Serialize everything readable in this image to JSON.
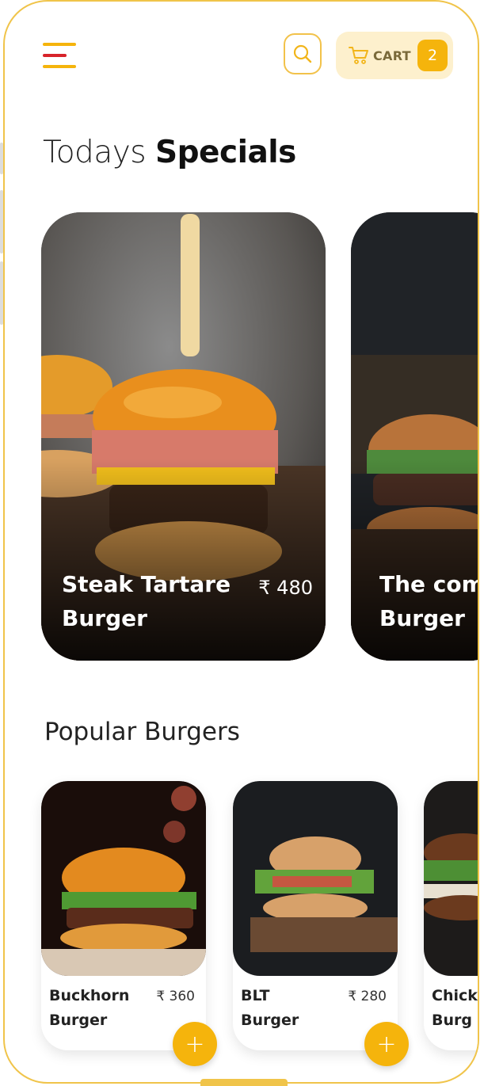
{
  "header": {
    "cart_label": "CART",
    "cart_count": "2"
  },
  "specials": {
    "heading_light": "Todays ",
    "heading_bold": "Specials",
    "items": [
      {
        "name_line1": "Steak Tartare",
        "name_line2": "Burger",
        "price": "₹ 480"
      },
      {
        "name_line1": "The com",
        "name_line2": "Burger",
        "price": ""
      }
    ]
  },
  "popular": {
    "heading": "Popular Burgers",
    "items": [
      {
        "name_line1": "Buckhorn",
        "name_line2": "Burger",
        "price": "₹ 360"
      },
      {
        "name_line1": "BLT",
        "name_line2": "Burger",
        "price": "₹ 280"
      },
      {
        "name_line1": "Chick",
        "name_line2": "Burg",
        "price": ""
      }
    ],
    "add_label": "+"
  },
  "colors": {
    "accent": "#f5b40c",
    "accent_light": "#fdf0cd",
    "menu_red": "#d7232a"
  },
  "icons": [
    "menu-icon",
    "search-icon",
    "cart-icon"
  ]
}
